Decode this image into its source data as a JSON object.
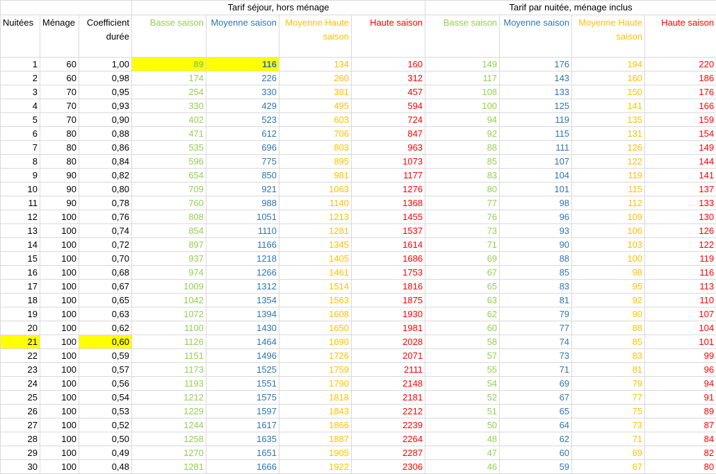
{
  "groups": {
    "sejour": "Tarif séjour, hors ménage",
    "nuitee": "Tarif par nuitée, ménage inclus"
  },
  "headers": {
    "nuitees": "Nuitées",
    "menage": "Ménage",
    "coef": "Coefficient durée",
    "basse": "Basse saison",
    "moyenne": "Moyenne saison",
    "moyenne_haute": "Moyenne Haute saison",
    "haute": "Haute saison"
  },
  "colors": {
    "basse": "#92d050",
    "moyenne": "#2e75b6",
    "moyenne_haute": "#ffc000",
    "haute": "#ff0000",
    "highlight": "#ffff00"
  },
  "rows": [
    [
      "1",
      "60",
      "1,00",
      "89",
      "116",
      "134",
      "160",
      "149",
      "176",
      "194",
      "220"
    ],
    [
      "2",
      "60",
      "0,98",
      "174",
      "226",
      "260",
      "312",
      "117",
      "143",
      "160",
      "186"
    ],
    [
      "3",
      "70",
      "0,95",
      "254",
      "330",
      "381",
      "457",
      "108",
      "133",
      "150",
      "176"
    ],
    [
      "4",
      "70",
      "0,93",
      "330",
      "429",
      "495",
      "594",
      "100",
      "125",
      "141",
      "166"
    ],
    [
      "5",
      "70",
      "0,90",
      "402",
      "523",
      "603",
      "724",
      "94",
      "119",
      "135",
      "159"
    ],
    [
      "6",
      "80",
      "0,88",
      "471",
      "612",
      "706",
      "847",
      "92",
      "115",
      "131",
      "154"
    ],
    [
      "7",
      "80",
      "0,86",
      "535",
      "696",
      "803",
      "963",
      "88",
      "111",
      "126",
      "149"
    ],
    [
      "8",
      "80",
      "0,84",
      "596",
      "775",
      "895",
      "1073",
      "85",
      "107",
      "122",
      "144"
    ],
    [
      "9",
      "90",
      "0,82",
      "654",
      "850",
      "981",
      "1177",
      "83",
      "104",
      "119",
      "141"
    ],
    [
      "10",
      "90",
      "0,80",
      "709",
      "921",
      "1063",
      "1276",
      "80",
      "101",
      "115",
      "137"
    ],
    [
      "11",
      "90",
      "0,78",
      "760",
      "988",
      "1140",
      "1368",
      "77",
      "98",
      "112",
      "133"
    ],
    [
      "12",
      "100",
      "0,76",
      "808",
      "1051",
      "1213",
      "1455",
      "76",
      "96",
      "109",
      "130"
    ],
    [
      "13",
      "100",
      "0,74",
      "854",
      "1110",
      "1281",
      "1537",
      "73",
      "93",
      "106",
      "126"
    ],
    [
      "14",
      "100",
      "0,72",
      "897",
      "1166",
      "1345",
      "1614",
      "71",
      "90",
      "103",
      "122"
    ],
    [
      "15",
      "100",
      "0,70",
      "937",
      "1218",
      "1405",
      "1686",
      "69",
      "88",
      "100",
      "119"
    ],
    [
      "16",
      "100",
      "0,68",
      "974",
      "1266",
      "1461",
      "1753",
      "67",
      "85",
      "98",
      "116"
    ],
    [
      "17",
      "100",
      "0,67",
      "1009",
      "1312",
      "1514",
      "1816",
      "65",
      "83",
      "95",
      "113"
    ],
    [
      "18",
      "100",
      "0,65",
      "1042",
      "1354",
      "1563",
      "1875",
      "63",
      "81",
      "92",
      "110"
    ],
    [
      "19",
      "100",
      "0,63",
      "1072",
      "1394",
      "1608",
      "1930",
      "62",
      "79",
      "90",
      "107"
    ],
    [
      "20",
      "100",
      "0,62",
      "1100",
      "1430",
      "1650",
      "1981",
      "60",
      "77",
      "88",
      "104"
    ],
    [
      "21",
      "100",
      "0,60",
      "1126",
      "1464",
      "1690",
      "2028",
      "58",
      "74",
      "85",
      "101"
    ],
    [
      "22",
      "100",
      "0,59",
      "1151",
      "1496",
      "1726",
      "2071",
      "57",
      "73",
      "83",
      "99"
    ],
    [
      "23",
      "100",
      "0,57",
      "1173",
      "1525",
      "1759",
      "2111",
      "55",
      "71",
      "81",
      "96"
    ],
    [
      "24",
      "100",
      "0,56",
      "1193",
      "1551",
      "1790",
      "2148",
      "54",
      "69",
      "79",
      "94"
    ],
    [
      "25",
      "100",
      "0,54",
      "1212",
      "1575",
      "1818",
      "2181",
      "52",
      "67",
      "77",
      "91"
    ],
    [
      "26",
      "100",
      "0,53",
      "1229",
      "1597",
      "1843",
      "2212",
      "51",
      "65",
      "75",
      "89"
    ],
    [
      "27",
      "100",
      "0,52",
      "1244",
      "1617",
      "1866",
      "2239",
      "50",
      "64",
      "73",
      "87"
    ],
    [
      "28",
      "100",
      "0,50",
      "1258",
      "1635",
      "1887",
      "2264",
      "48",
      "62",
      "71",
      "84"
    ],
    [
      "29",
      "100",
      "0,49",
      "1270",
      "1651",
      "1905",
      "2287",
      "47",
      "60",
      "69",
      "82"
    ],
    [
      "30",
      "100",
      "0,48",
      "1281",
      "1666",
      "1922",
      "2306",
      "46",
      "59",
      "67",
      "80"
    ]
  ]
}
